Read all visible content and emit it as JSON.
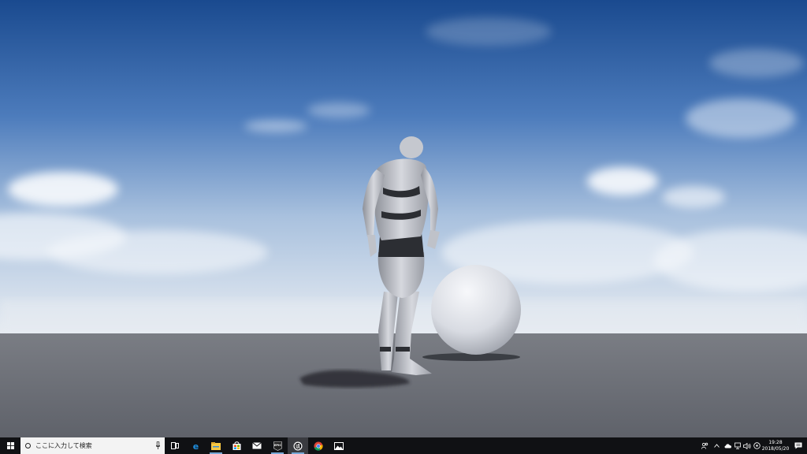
{
  "taskbar": {
    "search_placeholder": "ここに入力して検索",
    "apps": [
      {
        "name": "task-view-icon",
        "running": false
      },
      {
        "name": "edge-icon",
        "running": false
      },
      {
        "name": "file-explorer-icon",
        "running": true
      },
      {
        "name": "store-icon",
        "running": false
      },
      {
        "name": "mail-icon",
        "running": false
      },
      {
        "name": "epic-games-icon",
        "running": true
      },
      {
        "name": "unreal-engine-icon",
        "running": true,
        "active": true
      },
      {
        "name": "chrome-icon",
        "running": false
      },
      {
        "name": "photos-icon",
        "running": false
      }
    ],
    "epic_label": "EPIC",
    "clock": {
      "time": "19:28",
      "date": "2018/05/20"
    }
  },
  "colors": {
    "sky_top": "#1d4f95",
    "sky_mid": "#6b94c7",
    "sky_horizon": "#dfe6ee",
    "ground": "#6a6d74",
    "taskbar": "#101114"
  }
}
